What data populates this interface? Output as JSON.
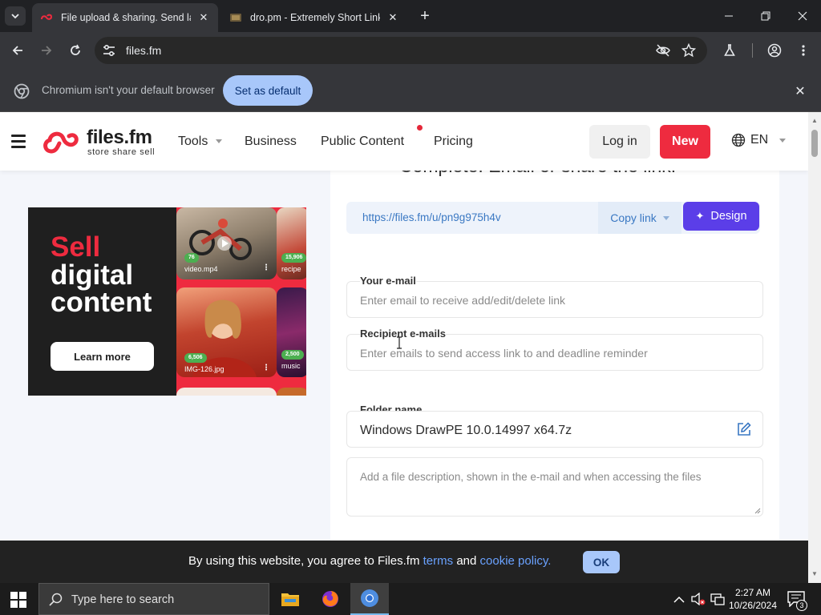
{
  "browser": {
    "tabs": [
      {
        "title": "File upload & sharing. Send larg",
        "active": true
      },
      {
        "title": "dro.pm - Extremely Short Links",
        "active": false
      }
    ],
    "address": "files.fm",
    "infobar": {
      "message": "Chromium isn't your default browser",
      "button": "Set as default"
    }
  },
  "site": {
    "logo": {
      "brand": "files.fm",
      "tagline": "store share sell"
    },
    "nav": {
      "tools": "Tools",
      "business": "Business",
      "public_content": "Public Content",
      "pricing": "Pricing"
    },
    "login": "Log in",
    "new": "New",
    "language": "EN"
  },
  "ad": {
    "line1": "Sell",
    "line2": "digital",
    "line3": "content",
    "button": "Learn more",
    "cards": [
      {
        "badge": "76",
        "caption": "video.mp4"
      },
      {
        "badge": "15,906",
        "caption": "recipe"
      },
      {
        "badge": "6,506",
        "caption": "IMG-126.jpg"
      },
      {
        "badge": "2,500",
        "caption": "music"
      }
    ]
  },
  "form": {
    "heading": "Complete: Email or share the link!",
    "share_link": "https://files.fm/u/pn9g975h4v",
    "copy_link": "Copy link",
    "design": "Design",
    "email_label": "Your e-mail",
    "email_placeholder": "Enter email to receive add/edit/delete link",
    "recipients_label": "Recipient e-mails",
    "recipients_placeholder": "Enter emails to send access link to and deadline reminder",
    "folder_label": "Folder name",
    "folder_value": "Windows DrawPE 10.0.14997 x64.7z",
    "description_placeholder": "Add a file description, shown in the e-mail and when accessing the files"
  },
  "cookie": {
    "text_before": "By using this website, you agree to Files.fm",
    "terms": "terms",
    "and": "and",
    "policy": "cookie policy.",
    "ok": "OK"
  },
  "taskbar": {
    "search_placeholder": "Type here to search",
    "time": "2:27 AM",
    "date": "10/26/2024",
    "notification_count": "3"
  },
  "colors": {
    "accent_red": "#ee2b3f",
    "design_purple": "#5b3ee8",
    "link_blue": "#3a78c3"
  }
}
